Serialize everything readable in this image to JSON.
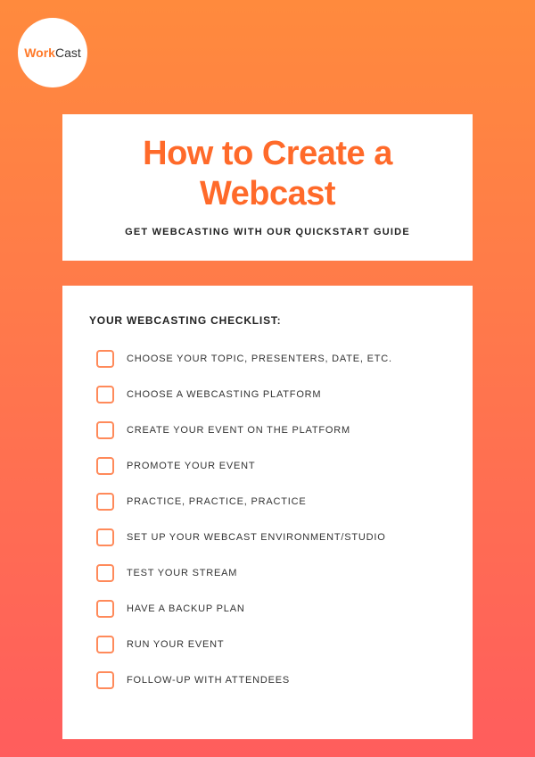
{
  "logo": {
    "part1": "Work",
    "part2": "Cast"
  },
  "header": {
    "title": "How to Create a Webcast",
    "subtitle": "GET WEBCASTING WITH OUR QUICKSTART GUIDE"
  },
  "checklist": {
    "heading": "YOUR WEBCASTING CHECKLIST:",
    "items": [
      "CHOOSE YOUR TOPIC, PRESENTERS, DATE, ETC.",
      "CHOOSE A WEBCASTING PLATFORM",
      "CREATE YOUR EVENT ON THE PLATFORM",
      "PROMOTE YOUR EVENT",
      "PRACTICE, PRACTICE, PRACTICE",
      "SET UP YOUR WEBCAST ENVIRONMENT/STUDIO",
      "TEST YOUR STREAM",
      "HAVE A BACKUP PLAN",
      "RUN YOUR EVENT",
      "FOLLOW-UP WITH ATTENDEES"
    ]
  }
}
